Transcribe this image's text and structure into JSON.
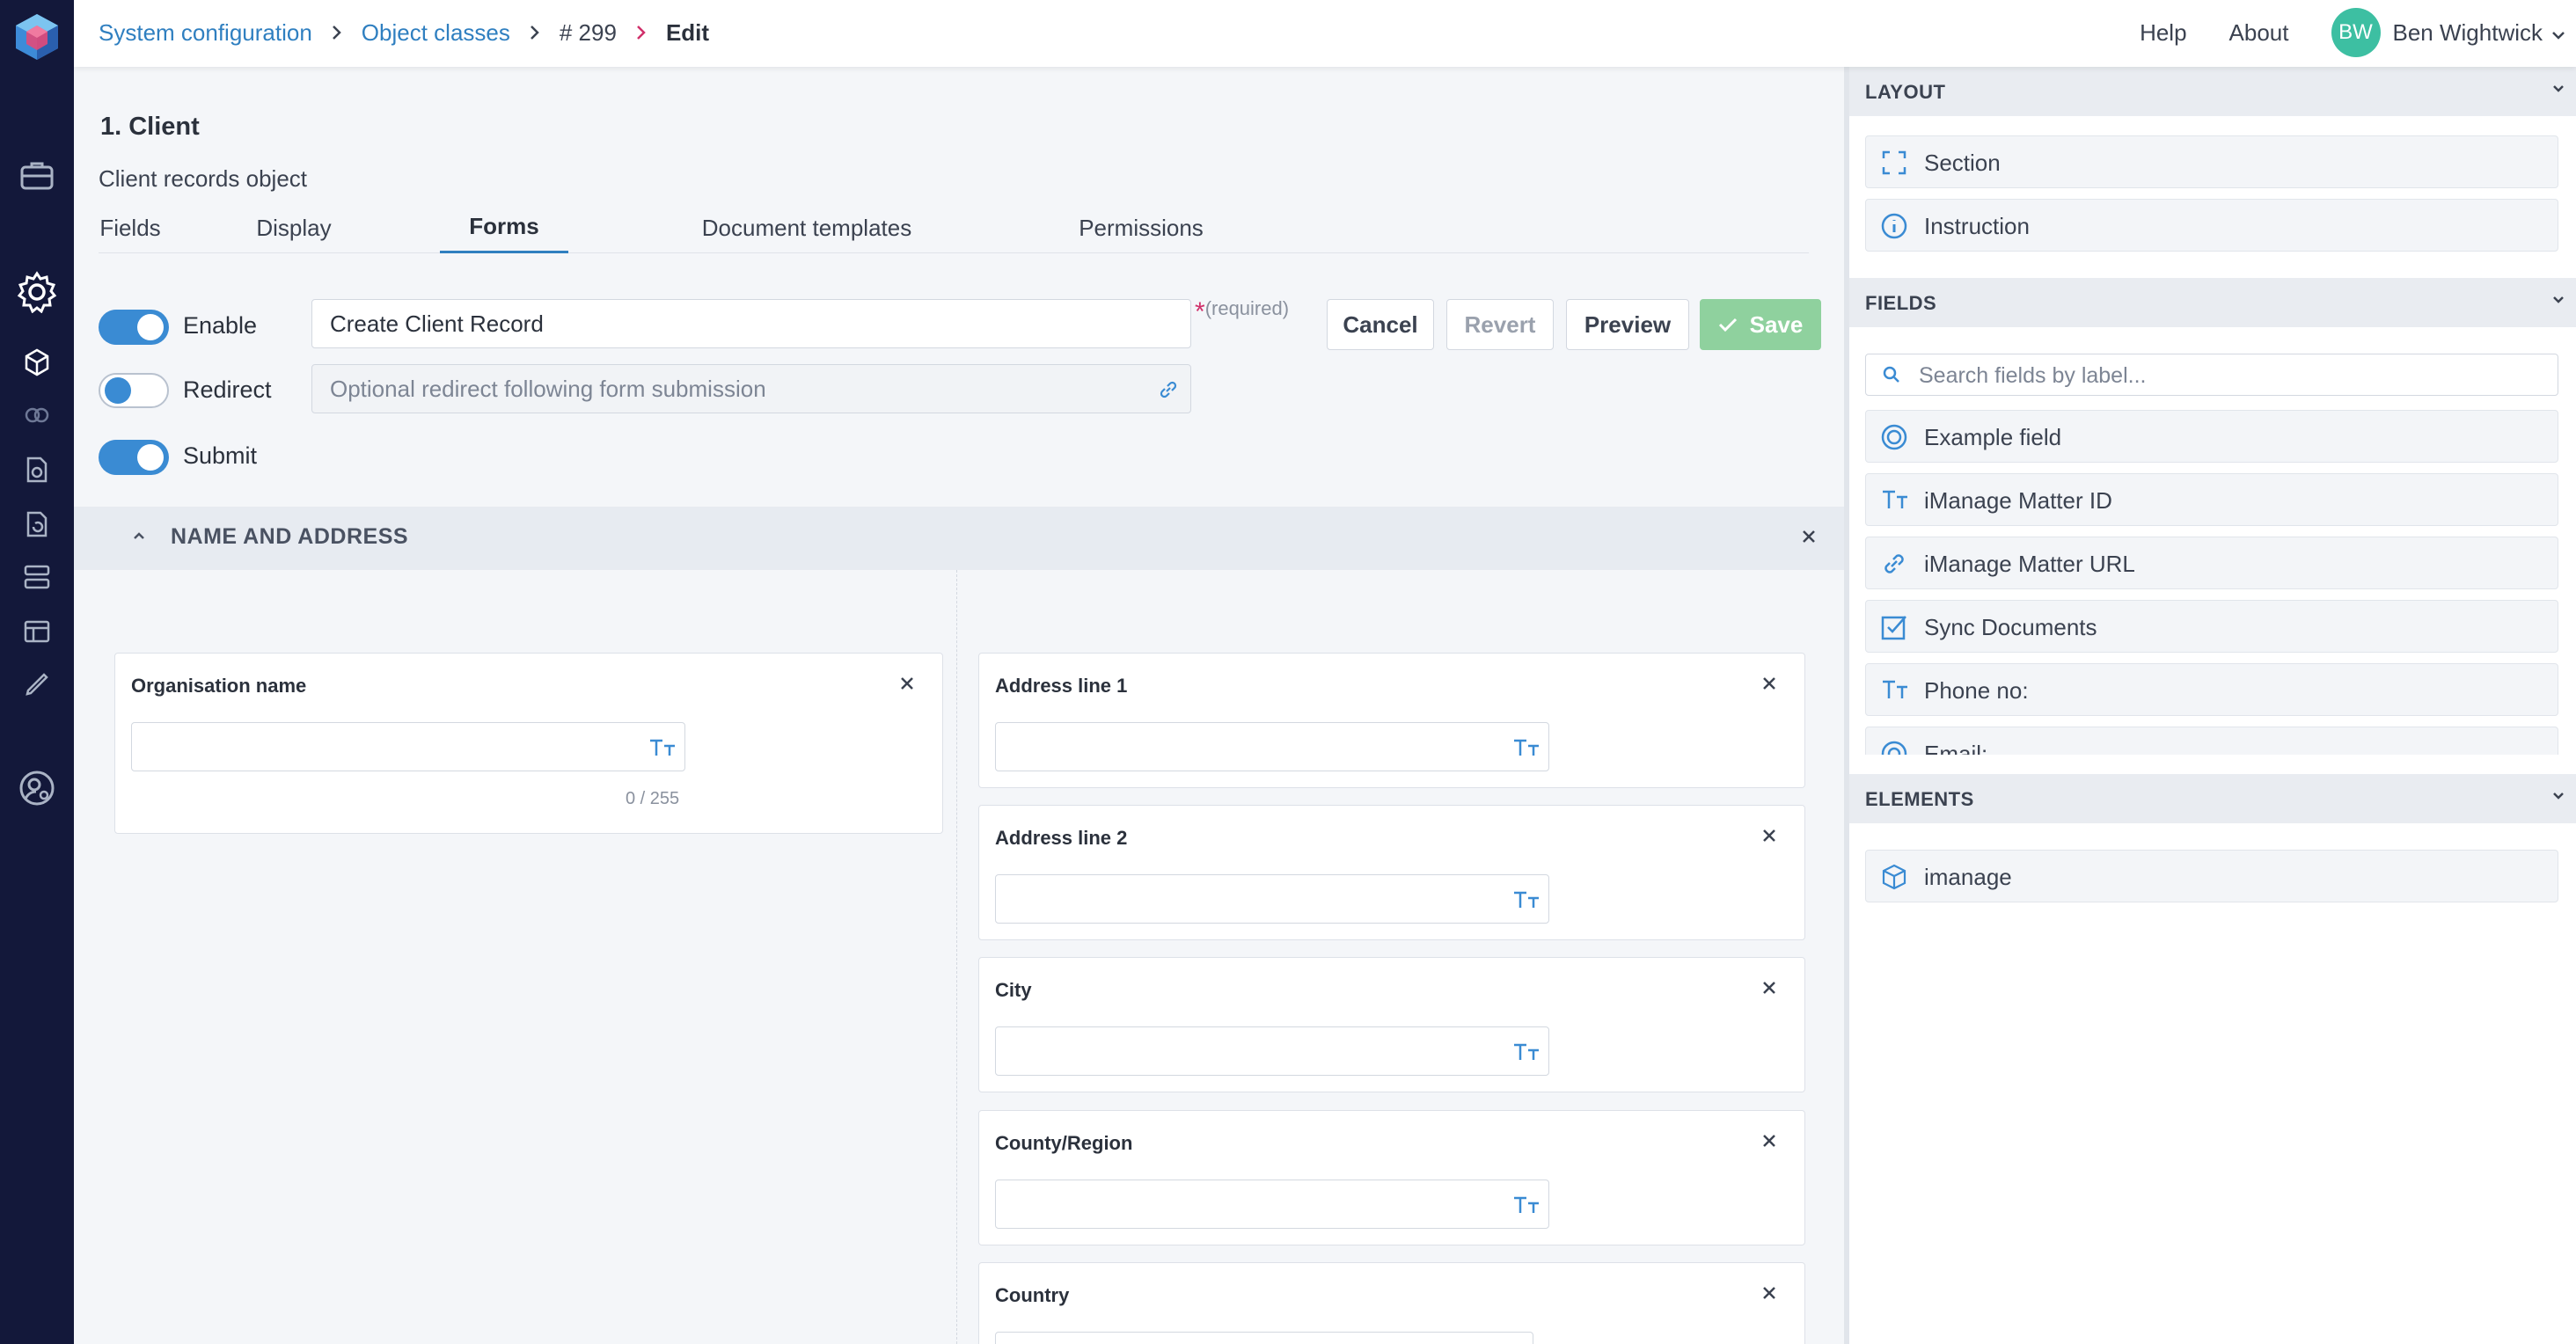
{
  "breadcrumb": {
    "items": [
      "System configuration",
      "Object classes",
      "# 299",
      "Edit"
    ]
  },
  "topbar": {
    "help": "Help",
    "about": "About",
    "user_initials": "BW",
    "user_name": "Ben Wightwick"
  },
  "object": {
    "title": "1. Client",
    "subtitle": "Client records object"
  },
  "tabs": [
    {
      "label": "Fields",
      "active": false
    },
    {
      "label": "Display",
      "active": false
    },
    {
      "label": "Forms",
      "active": true
    },
    {
      "label": "Document templates",
      "active": false
    },
    {
      "label": "Permissions",
      "active": false
    }
  ],
  "form_settings": {
    "enable_label": "Enable",
    "enable_on": true,
    "redirect_label": "Redirect",
    "redirect_on": false,
    "submit_label": "Submit",
    "submit_on": true,
    "name_value": "Create Client Record",
    "required_mark": "*",
    "required_text": "(required)",
    "redirect_placeholder": "Optional redirect following form submission"
  },
  "actions": {
    "cancel": "Cancel",
    "revert": "Revert",
    "preview": "Preview",
    "save": "Save"
  },
  "section": {
    "title": "NAME AND ADDRESS"
  },
  "left_fields": [
    {
      "label": "Organisation name",
      "counter": "0 / 255"
    }
  ],
  "right_fields": [
    {
      "label": "Address line 1"
    },
    {
      "label": "Address line 2"
    },
    {
      "label": "City"
    },
    {
      "label": "County/Region"
    },
    {
      "label": "Country"
    }
  ],
  "panel": {
    "layout_header": "LAYOUT",
    "layout_items": [
      "Section",
      "Instruction"
    ],
    "fields_header": "FIELDS",
    "search_placeholder": "Search fields by label...",
    "field_items": [
      "Example field",
      "iManage Matter ID",
      "iManage Matter URL",
      "Sync Documents",
      "Phone no:",
      "Email:"
    ],
    "elements_header": "ELEMENTS",
    "element_items": [
      "imanage"
    ]
  },
  "colors": {
    "rail": "#13183a",
    "link": "#2f7fc0",
    "toggle_on": "#3a8bd3",
    "save_button": "#8fd19e",
    "avatar": "#3dbfa2"
  }
}
